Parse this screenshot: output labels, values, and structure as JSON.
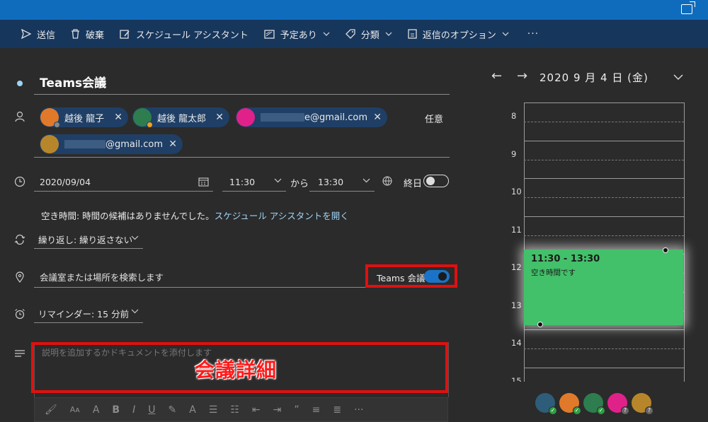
{
  "toolbar": {
    "send": "送信",
    "discard": "破棄",
    "scheduling_assistant": "スケジュール アシスタント",
    "show_as": "予定あり",
    "categorize": "分類",
    "response_options": "返信のオプション",
    "more": "···"
  },
  "event": {
    "title": "Teams会議",
    "optional_label": "任意",
    "attendees": [
      {
        "name": "越後 龍子",
        "avatar_color": "#e07a2a",
        "status_color": "#888888"
      },
      {
        "name": "越後 龍太郎",
        "avatar_color": "#2e7d4f",
        "status_color": "#f0a020"
      },
      {
        "name": "e@gmail.com",
        "avatar_color": "#e0218a",
        "status_color": ""
      },
      {
        "name": "@gmail.com",
        "avatar_color": "#b8862a",
        "status_color": ""
      }
    ],
    "date": "2020/09/04",
    "start_time": "11:30",
    "from_label": "から",
    "end_time": "13:30",
    "all_day_label": "終日",
    "availability_text": "空き時間:  時間の候補はありませんでした。",
    "availability_link": "スケジュール アシスタントを開く",
    "repeat": "繰り返し: 繰り返さない",
    "location_placeholder": "会議室または場所を検索します",
    "teams_label": "Teams 会議",
    "reminder": "リマインダー: 15 分前",
    "description_placeholder": "説明を追加するかドキュメントを添付します",
    "annotation": "会議詳細"
  },
  "calendar": {
    "date_heading": "2020 9 月 4 日 (金)",
    "hours": [
      "8",
      "9",
      "10",
      "11",
      "12",
      "13",
      "14",
      "15"
    ],
    "event_time": "11:30 - 13:30",
    "event_status": "空き時間です",
    "event_color": "#43c06a"
  },
  "colors": {
    "accent": "#0f6cbd",
    "toolbar": "#17365c",
    "background": "#2b2b2b",
    "highlight": "#e01010"
  }
}
